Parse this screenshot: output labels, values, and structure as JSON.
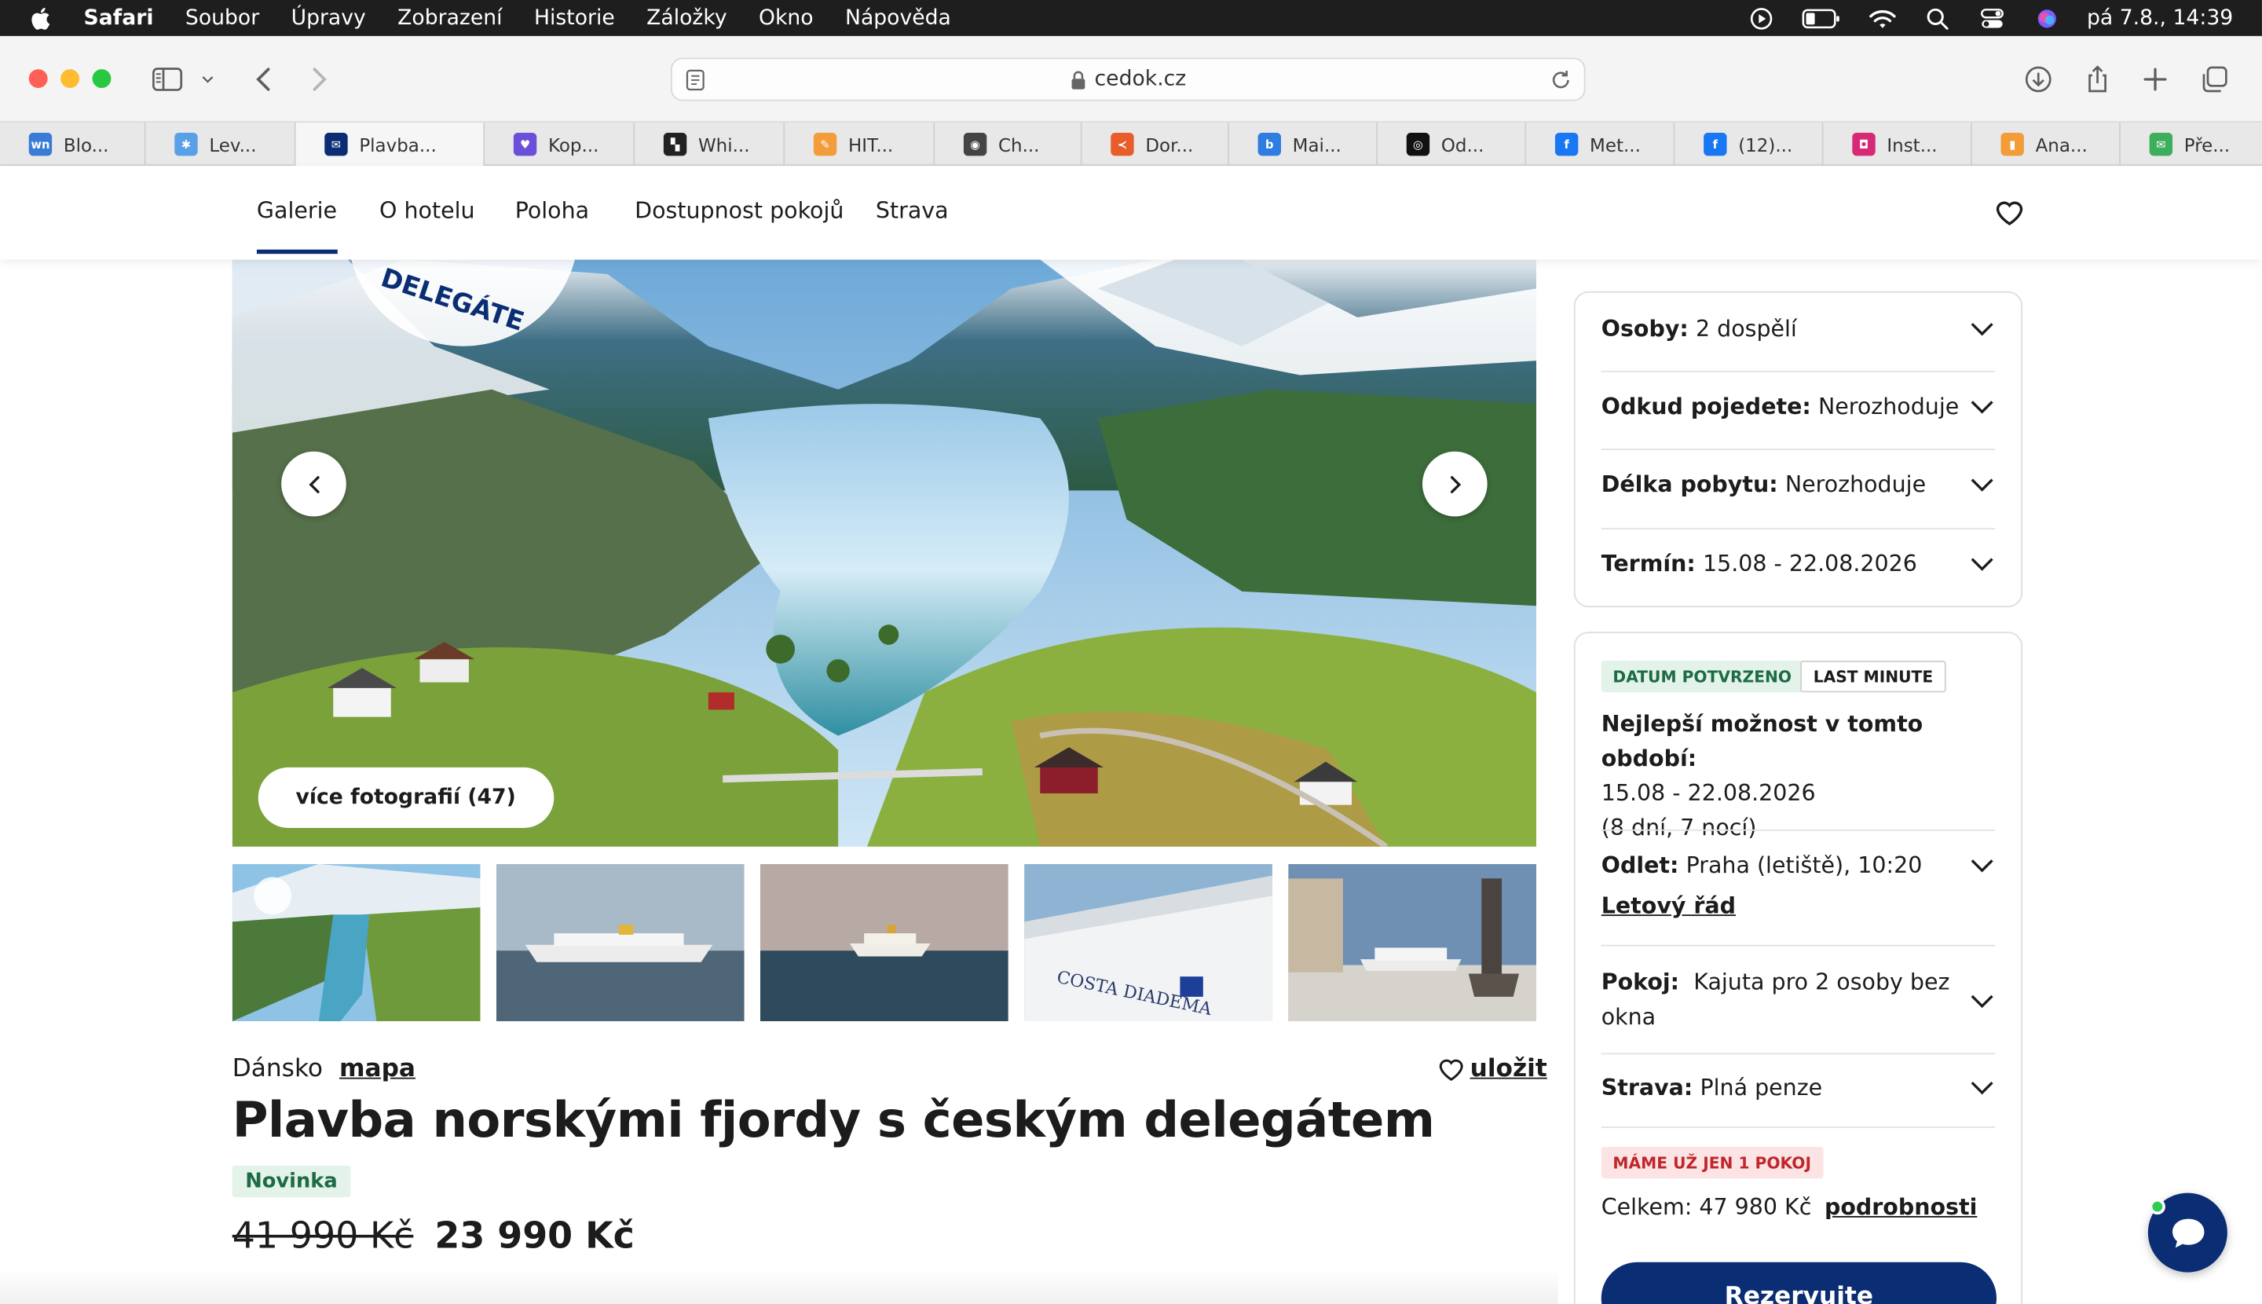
{
  "menubar": {
    "app": "Safari",
    "items": [
      "Soubor",
      "Úpravy",
      "Zobrazení",
      "Historie",
      "Záložky",
      "Okno",
      "Nápověda"
    ],
    "clock": "pá 7.8., 14:39"
  },
  "browser": {
    "url": "cedok.cz",
    "tabs": [
      {
        "label": "Blo...",
        "color": "#3a7bd5",
        "glyph": "wn"
      },
      {
        "label": "Lev...",
        "color": "#5aa0e6",
        "glyph": "✱"
      },
      {
        "label": "Plavba...",
        "color": "#0b2d73",
        "glyph": "✉"
      },
      {
        "label": "Kop...",
        "color": "#6b4fd8",
        "glyph": "♥"
      },
      {
        "label": "Whi...",
        "color": "#222222",
        "glyph": "▚"
      },
      {
        "label": "HIT...",
        "color": "#f39c3c",
        "glyph": "✎"
      },
      {
        "label": "Ch...",
        "color": "#444444",
        "glyph": "◉"
      },
      {
        "label": "Dor...",
        "color": "#e85d2a",
        "glyph": "≺"
      },
      {
        "label": "Mai...",
        "color": "#2f7de1",
        "glyph": "b"
      },
      {
        "label": "Od...",
        "color": "#111111",
        "glyph": "◎"
      },
      {
        "label": "Met...",
        "color": "#1877f2",
        "glyph": "f"
      },
      {
        "label": "(12)...",
        "color": "#1877f2",
        "glyph": "f"
      },
      {
        "label": "Inst...",
        "color": "#d62976",
        "glyph": "◘"
      },
      {
        "label": "Ana...",
        "color": "#f29d38",
        "glyph": "▮"
      },
      {
        "label": "Pře...",
        "color": "#3cae5c",
        "glyph": "✉"
      }
    ]
  },
  "sitenav": {
    "links": [
      "Galerie",
      "O hotelu",
      "Poloha",
      "Dostupnost pokojů",
      "Strava"
    ]
  },
  "gallery": {
    "more_photos": "více fotografií (47)"
  },
  "hotel": {
    "country": "Dánsko",
    "map_link": "mapa",
    "save_label": "uložit",
    "title": "Plavba norskými fjordy s českým delegátem",
    "badge": "Novinka",
    "old_price": "41 990 Kč",
    "price": "23 990 Kč"
  },
  "filters": {
    "persons_label": "Osoby:",
    "persons_value": "2 dospělí",
    "from_label": "Odkud pojedete:",
    "from_value": "Nerozhoduje",
    "length_label": "Délka pobytu:",
    "length_value": "Nerozhoduje",
    "term_label": "Termín:",
    "term_value": "15.08 - 22.08.2026"
  },
  "offer": {
    "tag_confirmed": "DATUM POTVRZENO",
    "tag_lastminute": "LAST MINUTE",
    "best_title": "Nejlepší možnost v tomto období:",
    "best_dates": "15.08 - 22.08.2026",
    "best_length": "(8 dní, 7 nocí)",
    "departure_label": "Odlet:",
    "departure_value": "Praha (letiště), 10:20",
    "schedule_link": "Letový řád",
    "room_label": "Pokoj:",
    "room_value": "Kajuta pro 2 osoby bez okna",
    "board_label": "Strava:",
    "board_value": "Plná penze",
    "tag_lastroom": "MÁME UŽ JEN 1 POKOJ",
    "total_label": "Celkem: 47 980 Kč",
    "details_link": "podrobnosti",
    "reserve_button": "Rezervujte"
  }
}
